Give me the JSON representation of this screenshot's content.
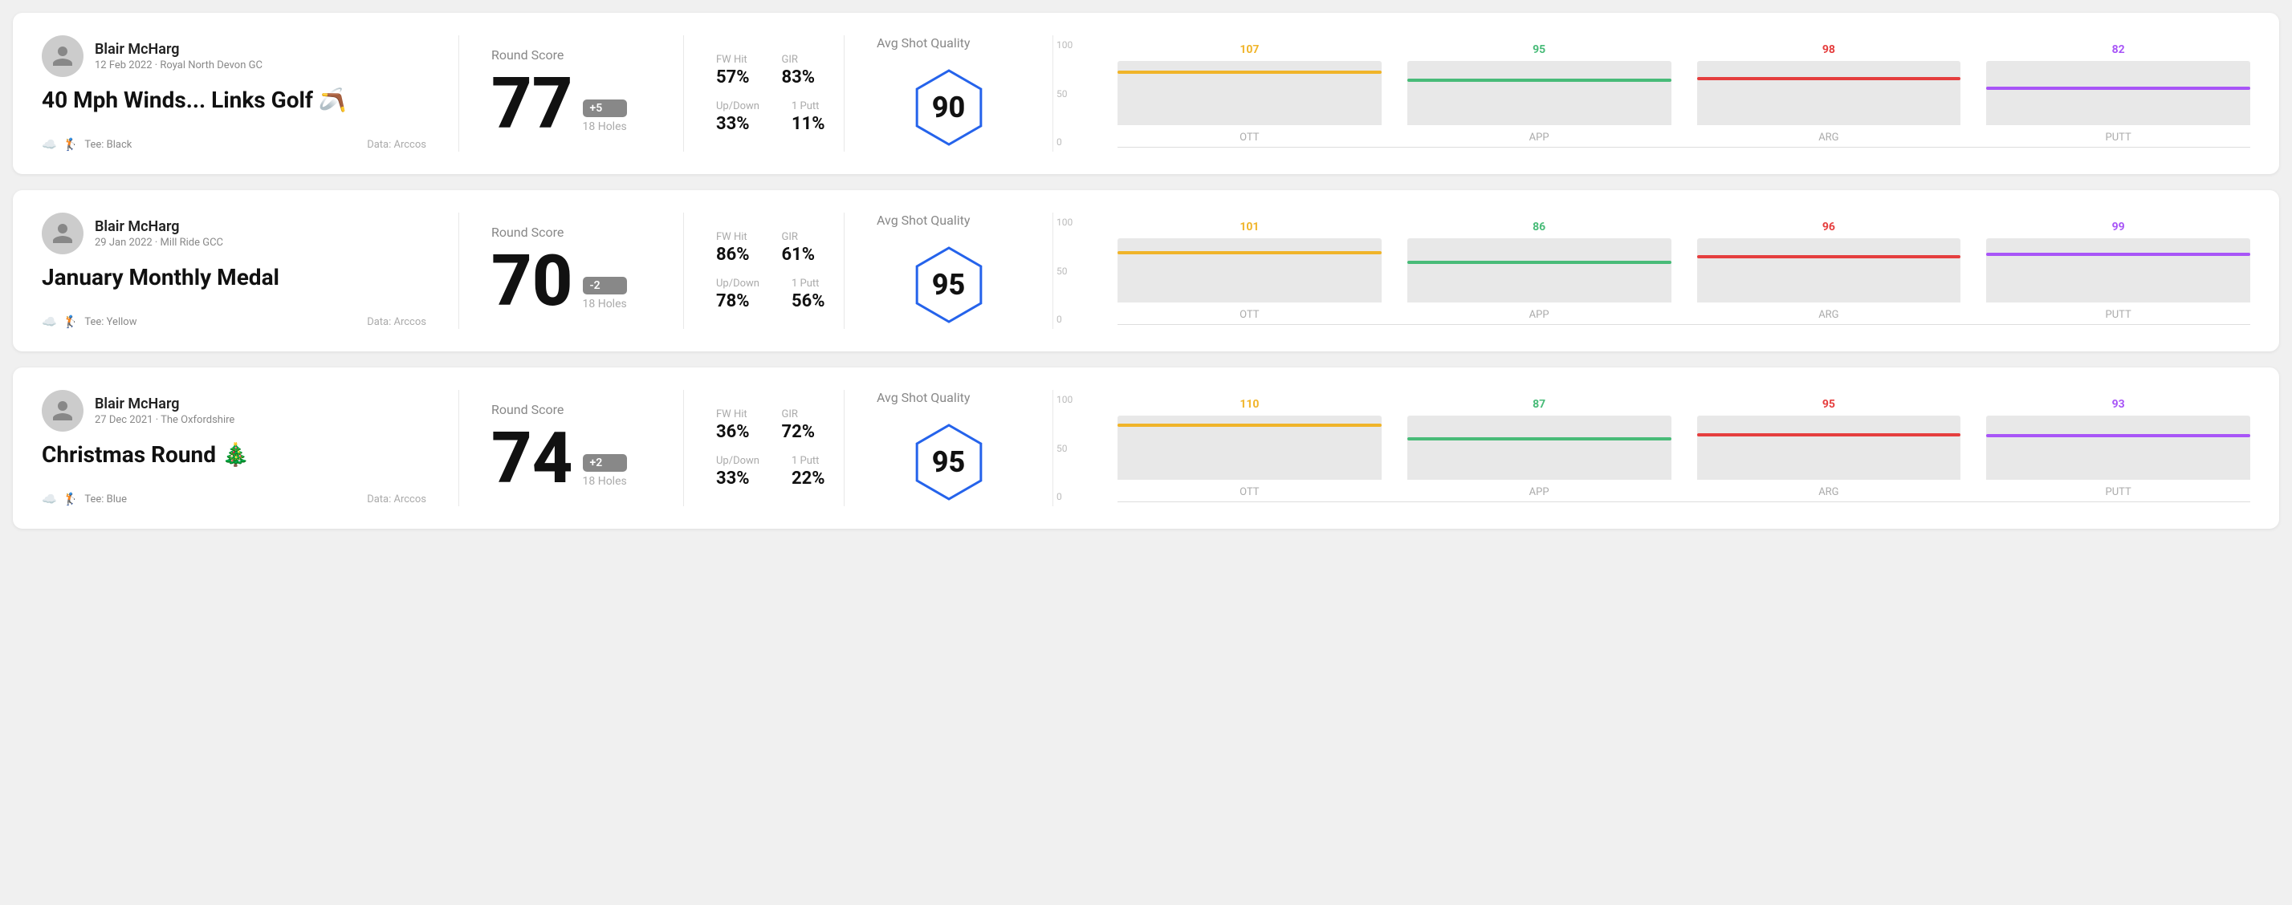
{
  "rounds": [
    {
      "id": "round-1",
      "user_name": "Blair McHarg",
      "user_meta": "12 Feb 2022 · Royal North Devon GC",
      "round_title": "40 Mph Winds... Links Golf 🪃",
      "tee": "Black",
      "data_source": "Data: Arccos",
      "round_score_label": "Round Score",
      "score": "77",
      "score_diff": "+5",
      "score_diff_type": "plus",
      "holes": "18 Holes",
      "fw_hit_label": "FW Hit",
      "fw_hit_value": "57%",
      "gir_label": "GIR",
      "gir_value": "83%",
      "up_down_label": "Up/Down",
      "up_down_value": "33%",
      "one_putt_label": "1 Putt",
      "one_putt_value": "11%",
      "quality_label": "Avg Shot Quality",
      "quality_score": "90",
      "bars": [
        {
          "label": "OTT",
          "value": 107,
          "color": "#f0b429",
          "height_pct": 85
        },
        {
          "label": "APP",
          "value": 95,
          "color": "#48bb78",
          "height_pct": 72
        },
        {
          "label": "ARG",
          "value": 98,
          "color": "#e53e3e",
          "height_pct": 75
        },
        {
          "label": "PUTT",
          "value": 82,
          "color": "#a855f7",
          "height_pct": 60
        }
      ]
    },
    {
      "id": "round-2",
      "user_name": "Blair McHarg",
      "user_meta": "29 Jan 2022 · Mill Ride GCC",
      "round_title": "January Monthly Medal",
      "tee": "Yellow",
      "data_source": "Data: Arccos",
      "round_score_label": "Round Score",
      "score": "70",
      "score_diff": "-2",
      "score_diff_type": "minus",
      "holes": "18 Holes",
      "fw_hit_label": "FW Hit",
      "fw_hit_value": "86%",
      "gir_label": "GIR",
      "gir_value": "61%",
      "up_down_label": "Up/Down",
      "up_down_value": "78%",
      "one_putt_label": "1 Putt",
      "one_putt_value": "56%",
      "quality_label": "Avg Shot Quality",
      "quality_score": "95",
      "bars": [
        {
          "label": "OTT",
          "value": 101,
          "color": "#f0b429",
          "height_pct": 80
        },
        {
          "label": "APP",
          "value": 86,
          "color": "#48bb78",
          "height_pct": 65
        },
        {
          "label": "ARG",
          "value": 96,
          "color": "#e53e3e",
          "height_pct": 74
        },
        {
          "label": "PUTT",
          "value": 99,
          "color": "#a855f7",
          "height_pct": 77
        }
      ]
    },
    {
      "id": "round-3",
      "user_name": "Blair McHarg",
      "user_meta": "27 Dec 2021 · The Oxfordshire",
      "round_title": "Christmas Round 🎄",
      "tee": "Blue",
      "data_source": "Data: Arccos",
      "round_score_label": "Round Score",
      "score": "74",
      "score_diff": "+2",
      "score_diff_type": "plus",
      "holes": "18 Holes",
      "fw_hit_label": "FW Hit",
      "fw_hit_value": "36%",
      "gir_label": "GIR",
      "gir_value": "72%",
      "up_down_label": "Up/Down",
      "up_down_value": "33%",
      "one_putt_label": "1 Putt",
      "one_putt_value": "22%",
      "quality_label": "Avg Shot Quality",
      "quality_score": "95",
      "bars": [
        {
          "label": "OTT",
          "value": 110,
          "color": "#f0b429",
          "height_pct": 88
        },
        {
          "label": "APP",
          "value": 87,
          "color": "#48bb78",
          "height_pct": 66
        },
        {
          "label": "ARG",
          "value": 95,
          "color": "#e53e3e",
          "height_pct": 73
        },
        {
          "label": "PUTT",
          "value": 93,
          "color": "#a855f7",
          "height_pct": 71
        }
      ]
    }
  ],
  "y_axis_labels": [
    "100",
    "50",
    "0"
  ]
}
